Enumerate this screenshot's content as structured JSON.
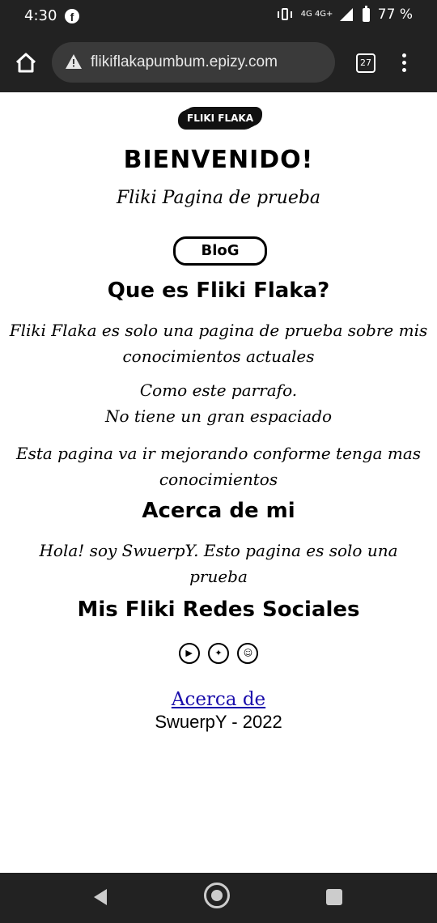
{
  "status_bar": {
    "time": "4:30",
    "network": "4G 4G+",
    "battery": "77 %",
    "icons": [
      "facebook-icon",
      "vibrate-icon",
      "signal-icon",
      "battery-icon"
    ]
  },
  "browser": {
    "url": "flikiflakapumbum.epizy.com",
    "tab_count": "27",
    "icons": [
      "home-icon",
      "warning-icon",
      "tabs-icon",
      "more-menu-icon"
    ]
  },
  "page": {
    "logo_text": "FLIKI FLAKA",
    "welcome": "BIENVENIDO!",
    "subtitle": "Fliki Pagina de prueba",
    "blog_button": "BloG",
    "section_what_title": "Que es Fliki Flaka?",
    "para1": "Fliki Flaka es solo una pagina de prueba sobre mis conocimientos actuales",
    "para2_line1": "Como este parrafo.",
    "para2_line2": "No tiene un gran espaciado",
    "para3": "Esta pagina va ir mejorando conforme tenga mas conocimientos",
    "section_about_title": "Acerca de mi",
    "para4": "Hola! soy SwuerpY. Esto pagina es solo una prueba",
    "section_social_title": "Mis Fliki Redes Sociales",
    "social_icons": [
      "youtube-icon",
      "twitter-icon",
      "discord-icon"
    ],
    "about_link": "Acerca de",
    "credit": "SwuerpY - 2022"
  },
  "nav_bar": {
    "icons": [
      "back-icon",
      "home-nav-icon",
      "recent-apps-icon"
    ]
  }
}
